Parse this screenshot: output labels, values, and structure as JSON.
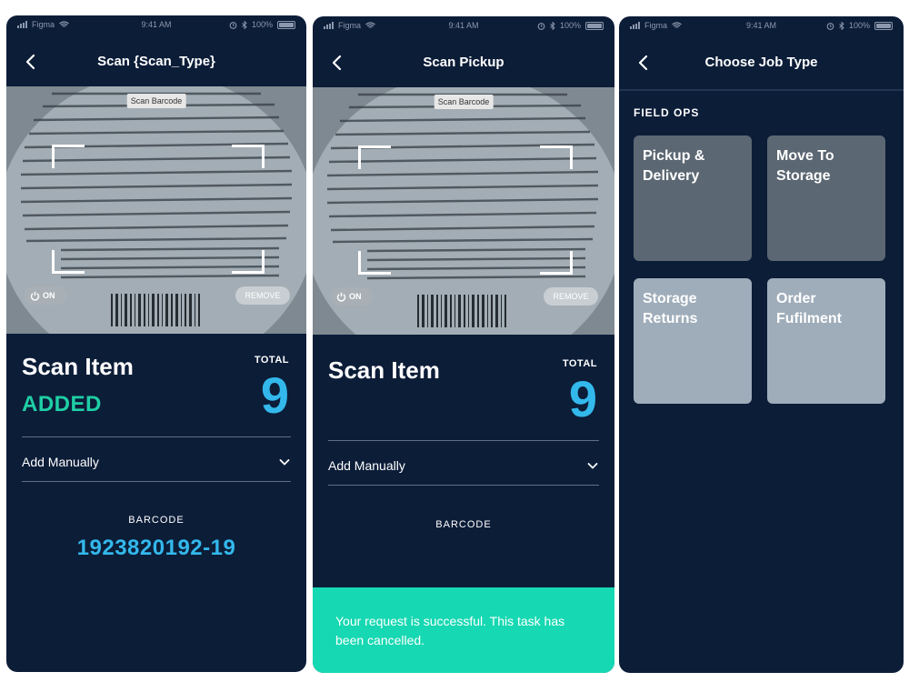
{
  "status_bar": {
    "carrier": "Figma",
    "time": "9:41 AM",
    "battery": "100%"
  },
  "screens": [
    {
      "title": "Scan {Scan_Type}",
      "camera_tag": "Scan Barcode",
      "toggle_label": "ON",
      "remove_label": "REMOVE",
      "scan_title": "Scan Item",
      "added_label": "ADDED",
      "total_label": "TOTAL",
      "total_value": "9",
      "add_manually_label": "Add Manually",
      "barcode_label": "BARCODE",
      "barcode_value": "1923820192-19"
    },
    {
      "title": "Scan Pickup",
      "camera_tag": "Scan Barcode",
      "toggle_label": "ON",
      "remove_label": "REMOVE",
      "scan_title": "Scan Item",
      "total_label": "TOTAL",
      "total_value": "9",
      "add_manually_label": "Add Manually",
      "barcode_label": "BARCODE",
      "toast": "Your request is successful. This task has been cancelled."
    },
    {
      "title": "Choose Job Type",
      "section_label": "FIELD OPS",
      "tiles": [
        {
          "line1": "Pickup &",
          "line2": "Delivery"
        },
        {
          "line1": "Move To",
          "line2": "Storage"
        },
        {
          "line1": "Storage",
          "line2": "Returns"
        },
        {
          "line1": "Order",
          "line2": "Fufilment"
        }
      ]
    }
  ],
  "colors": {
    "background": "#0c1d38",
    "accent_blue": "#33b8ec",
    "success_green": "#1fcfa5",
    "toast_green": "#16d8b2",
    "tile_dark": "#5b6772",
    "tile_light": "#9fadba"
  },
  "icons": [
    "back-arrow-icon",
    "wifi-icon",
    "signal-icon",
    "alarm-icon",
    "bluetooth-icon",
    "battery-icon",
    "power-icon",
    "chevron-down-icon"
  ]
}
